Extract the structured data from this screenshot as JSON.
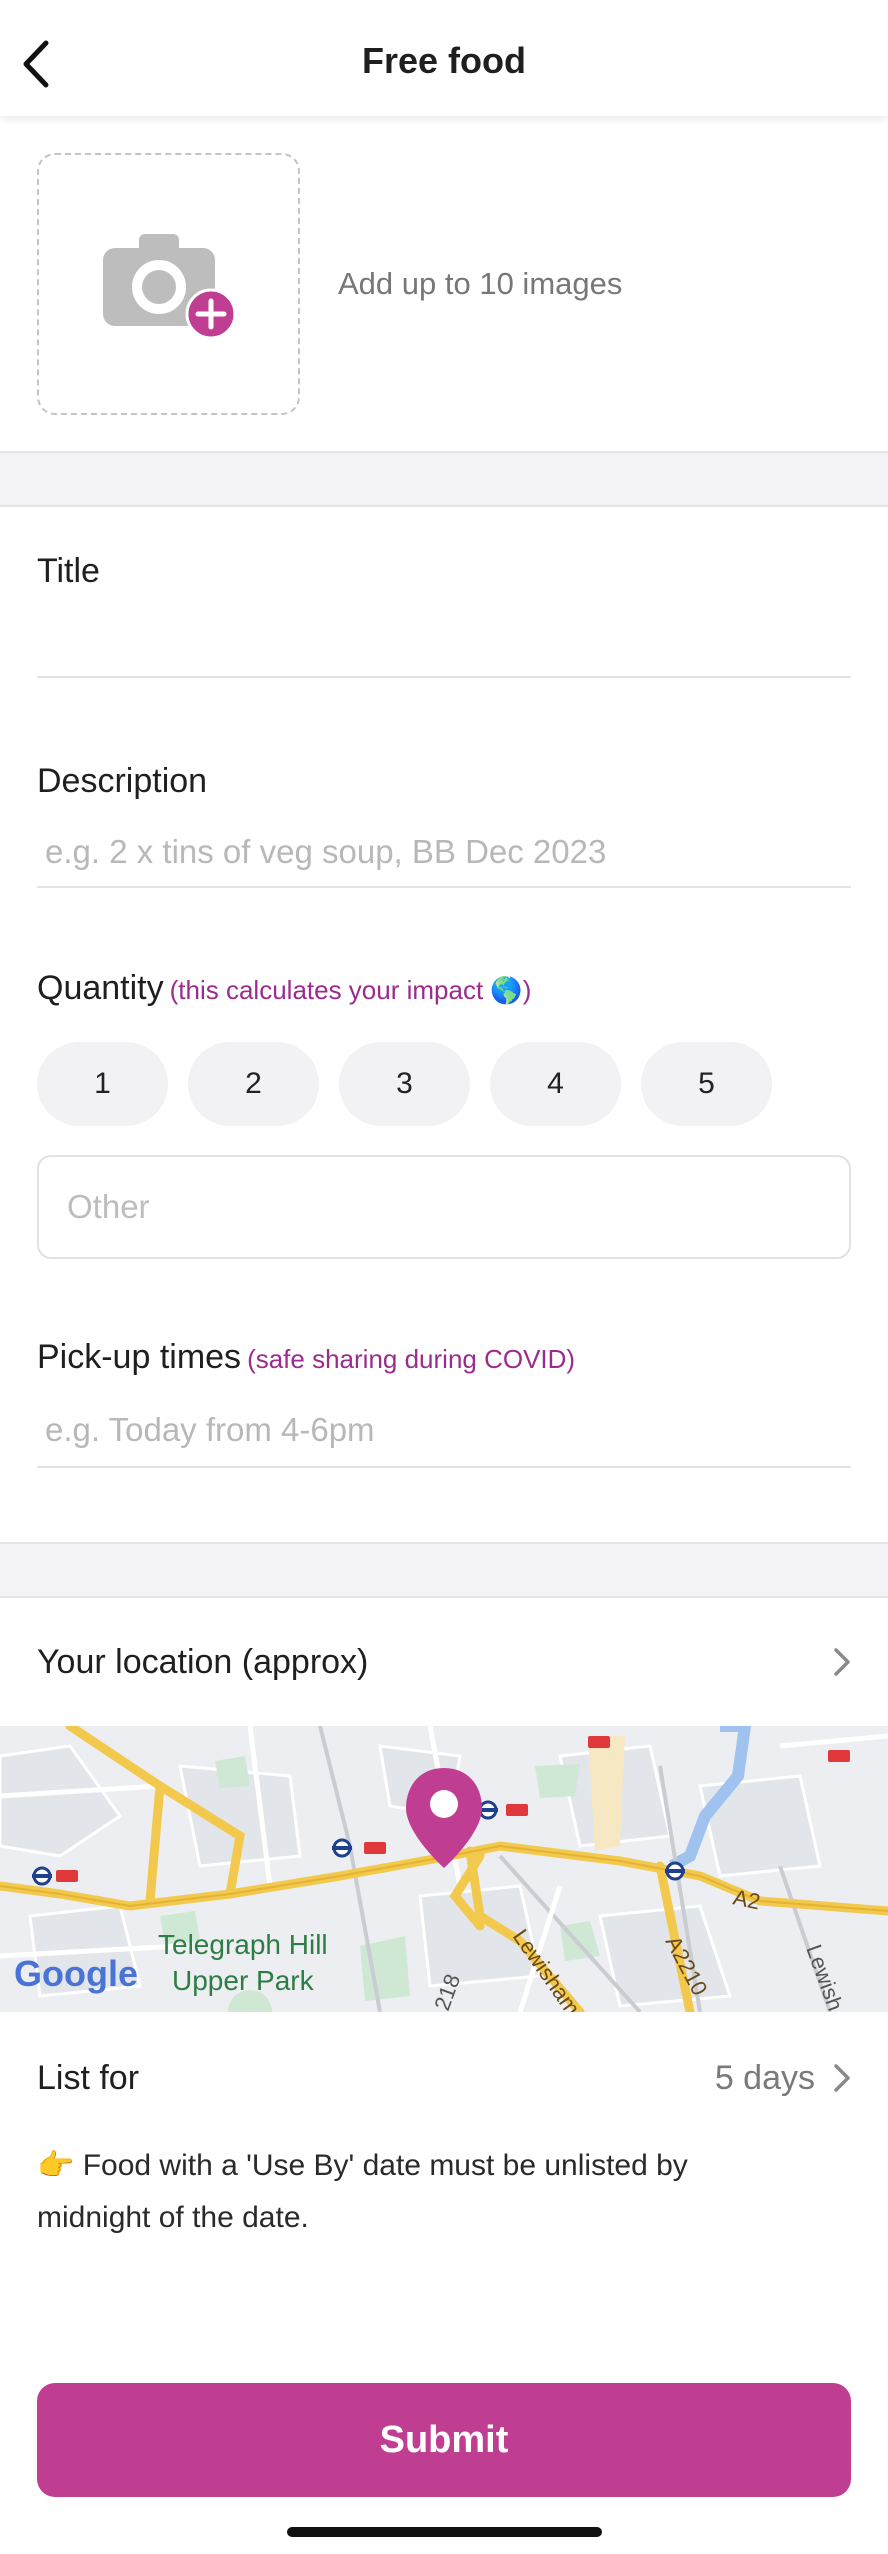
{
  "header": {
    "title": "Free food",
    "back_icon": "chevron-left-icon"
  },
  "photos": {
    "hint": "Add up to 10 images",
    "icon": "camera-add-icon"
  },
  "form": {
    "title_label": "Title",
    "title_value": "",
    "description_label": "Description",
    "description_placeholder": "e.g. 2 x tins of veg soup, BB Dec 2023",
    "quantity_label": "Quantity",
    "quantity_note": "(this calculates your impact 🌎)",
    "quantity_options": [
      "1",
      "2",
      "3",
      "4",
      "5"
    ],
    "other_placeholder": "Other",
    "pickup_label": "Pick-up times",
    "pickup_note": "(safe sharing during COVID)",
    "pickup_placeholder": "e.g. Today from 4-6pm"
  },
  "location": {
    "label": "Your location (approx)",
    "chevron_icon": "chevron-right-icon"
  },
  "map": {
    "labels": {
      "park_line1": "Telegraph Hill",
      "park_line2": "Upper Park",
      "road_a2": "A2",
      "road_a2210": "A2210",
      "road_lewisham": "Lewisham",
      "road_lewish": "Lewish",
      "road_218": "218"
    },
    "logo": "Google",
    "pin_icon": "map-pin-icon"
  },
  "list_for": {
    "label": "List for",
    "value": "5 days"
  },
  "notice": {
    "text": "👉 Food with a 'Use By' date must be unlisted by midnight of the date."
  },
  "submit": {
    "label": "Submit"
  },
  "colors": {
    "accent": "#c03e91",
    "note": "#9b2c8e"
  }
}
